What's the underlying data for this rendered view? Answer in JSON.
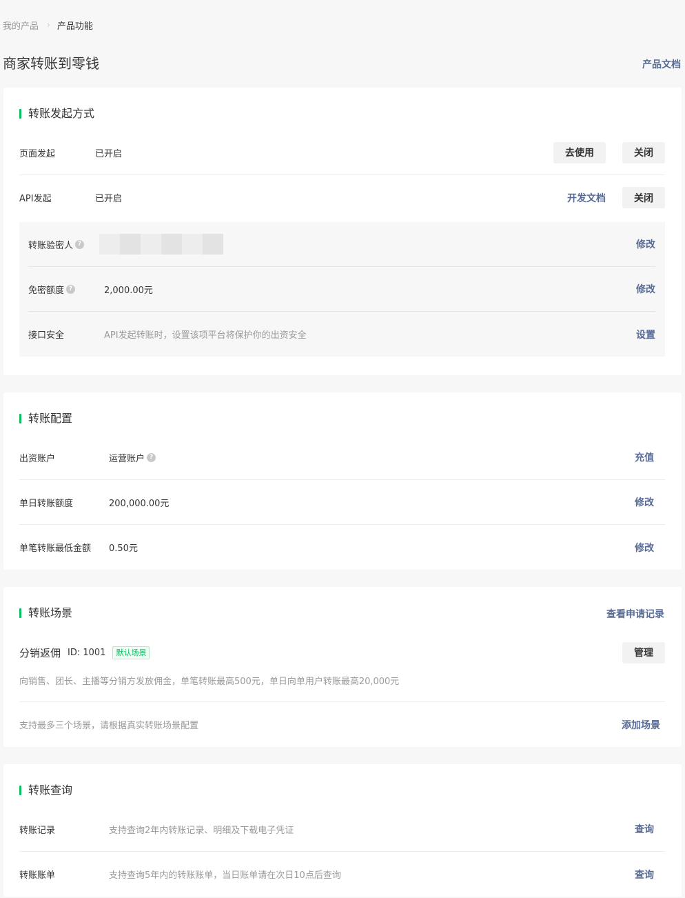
{
  "breadcrumb": {
    "parent": "我的产品",
    "separator": "›",
    "current": "产品功能"
  },
  "header": {
    "title": "商家转账到零钱",
    "doc_link": "产品文档"
  },
  "transfer_method": {
    "title": "转账发起方式",
    "page_row": {
      "label": "页面发起",
      "status": "已开启",
      "use_button": "去使用",
      "close_button": "关闭"
    },
    "api_row": {
      "label": "API发起",
      "status": "已开启",
      "doc_link": "开发文档",
      "close_button": "关闭"
    },
    "sub": {
      "verifier": {
        "label": "转账验密人",
        "action": "修改"
      },
      "quota": {
        "label": "免密额度",
        "value": "2,000.00元",
        "action": "修改"
      },
      "security": {
        "label": "接口安全",
        "desc": "API发起转账时，设置该项平台将保护你的出资安全",
        "action": "设置"
      }
    }
  },
  "transfer_config": {
    "title": "转账配置",
    "rows": [
      {
        "label": "出资账户",
        "value": "运营账户",
        "action": "充值"
      },
      {
        "label": "单日转账额度",
        "value": "200,000.00元",
        "action": "修改"
      },
      {
        "label": "单笔转账最低金额",
        "value": "0.50元",
        "action": "修改"
      }
    ]
  },
  "scenes": {
    "title": "转账场景",
    "records_link": "查看申请记录",
    "scene": {
      "name": "分销返佣",
      "id": "ID: 1001",
      "tag": "默认场景",
      "manage_button": "管理",
      "desc": "向销售、团长、主播等分销方发放佣金，单笔转账最高500元，单日向单用户转账最高20,000元"
    },
    "footer": {
      "note": "支持最多三个场景，请根据真实转账场景配置",
      "add_link": "添加场景"
    }
  },
  "query": {
    "title": "转账查询",
    "rows": [
      {
        "label": "转账记录",
        "desc": "支持查询2年内转账记录、明细及下载电子凭证",
        "action": "查询"
      },
      {
        "label": "转账账单",
        "desc": "支持查询5年内的转账账单，当日账单请在次日10点后查询",
        "action": "查询"
      }
    ]
  },
  "icons": {
    "help": "question-icon",
    "help_glyph": "?"
  },
  "colors": {
    "accent_green": "#07c160",
    "link_blue": "#576b95"
  }
}
